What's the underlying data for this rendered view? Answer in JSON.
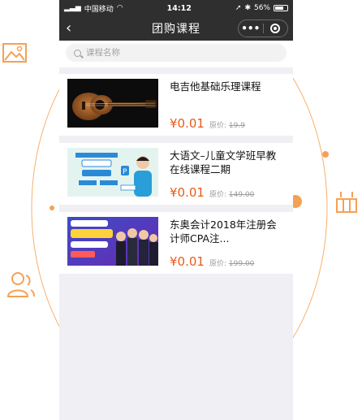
{
  "status_bar": {
    "carrier": "中国移动",
    "time": "14:12",
    "battery": "56%"
  },
  "nav": {
    "title": "团购课程",
    "more_label": "•••"
  },
  "search": {
    "placeholder": "课程名称"
  },
  "courses": [
    {
      "title": "电吉他基础乐理课程",
      "price": "¥0.01",
      "orig_label": "原价:",
      "orig_price": "19.9"
    },
    {
      "title": "大语文–儿童文学班早教在线课程二期",
      "price": "¥0.01",
      "orig_label": "原价:",
      "orig_price": "149.00"
    },
    {
      "title": "东奥会计2018年注册会计师CPA注...",
      "price": "¥0.01",
      "orig_label": "原价:",
      "orig_price": "199.00"
    }
  ],
  "colors": {
    "accent": "#e85a1a",
    "decor": "#f5a155",
    "navbar": "#2f2f2f"
  },
  "icons": [
    "image-icon",
    "user-icon",
    "grid-icon",
    "search-icon",
    "back-icon",
    "more-icon",
    "close-capsule-icon"
  ]
}
